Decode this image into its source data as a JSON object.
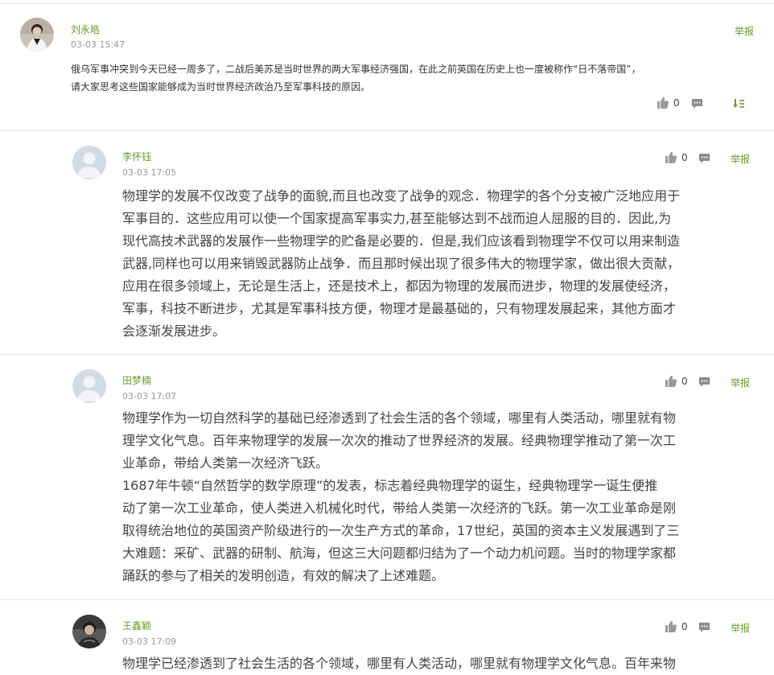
{
  "main_post": {
    "author": "刘永皓",
    "time": "03-03 15:47",
    "report": "举报",
    "text_line1": "俄乌军事冲突到今天已经一周多了，二战后美苏是当时世界的两大军事经济强国，在此之前英国在历史上也一度被称作“日不落帝国”，",
    "text_line2": "请大家思考这些国家能够成为当时世界经济政治乃至军事科技的原因。",
    "likes": "0"
  },
  "replies": [
    {
      "author": "李怀钰",
      "time": "03-03 17:05",
      "likes": "0",
      "report": "举报",
      "lines": [
        "物理学的发展不仅改变了战争的面貌,而且也改变了战争的观念．物理学的各个分支被广泛地应用于",
        "军事目的．这些应用可以使一个国家提高军事实力,甚至能够达到不战而迫人屈服的目的．因此,为",
        "现代高技术武器的发展作一些物理学的贮备是必要的．但是,我们应该看到物理学不仅可以用来制造",
        "武器,同样也可以用来销毁武器防止战争．而且那时候出现了很多伟大的物理学家，做出很大贡献，",
        "应用在很多领域上，无论是生活上，还是技术上，都因为物理的发展而进步，物理的发展使经济，",
        "军事，科技不断进步，尤其是军事科技方便，物理才是最基础的，只有物理发展起来，其他方面才",
        "会逐渐发展进步。"
      ]
    },
    {
      "author": "田梦楠",
      "time": "03-03 17:07",
      "likes": "0",
      "report": "举报",
      "lines": [
        "物理学作为一切自然科学的基础已经渗透到了社会生活的各个领域，哪里有人类活动，哪里就有物",
        "理学文化气息。百年来物理学的发展一次次的推动了世界经济的发展。经典物理学推动了第一次工",
        "业革命，带给人类第一次经济飞跃。",
        "1687年牛顿“自然哲学的数学原理”的发表，标志着经典物理学的诞生，经典物理学一诞生便推",
        "动了第一次工业革命，使人类进入机械化时代，带给人类第一次经济的飞跃。第一次工业革命是刚",
        "取得统治地位的英国资产阶级进行的一次生产方式的革命，17世纪，英国的资本主义发展遇到了三",
        "大难题：采矿、武器的研制、航海，但这三大问题都归结为了一个动力机问题。当时的物理学家都",
        "踊跃的参与了相关的发明创造，有效的解决了上述难题。"
      ]
    },
    {
      "author": "王鑫颖",
      "time": "03-03 17:09",
      "likes": "0",
      "report": "举报",
      "lines": [
        "物理学已经渗透到了社会生活的各个领域，哪里有人类活动，哪里就有物理学文化气息。百年来物"
      ]
    }
  ],
  "colors": {
    "accent": "#6a9a2c",
    "divider": "#e3e3e3",
    "time": "#999999"
  }
}
